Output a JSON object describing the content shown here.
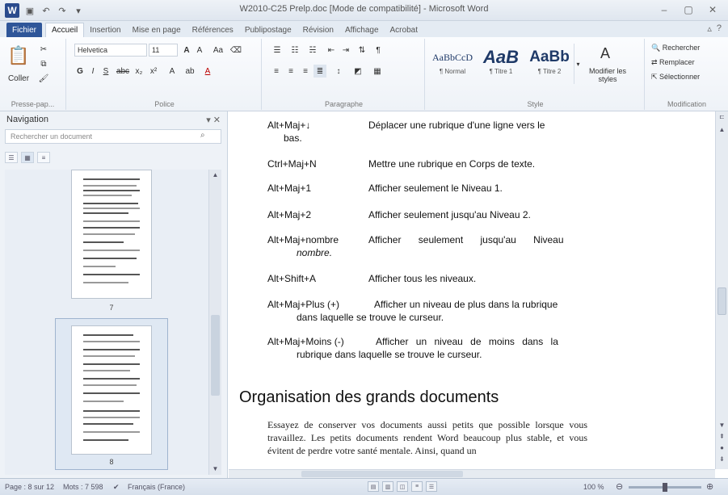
{
  "window": {
    "title": "W2010-C25 Prelp.doc [Mode de compatibilité] - Microsoft Word"
  },
  "qat": {
    "logo": "W",
    "save_icon": "save-icon",
    "undo_icon": "undo-icon",
    "redo_icon": "redo-icon"
  },
  "tabs": [
    {
      "label": "Fichier"
    },
    {
      "label": "Accueil"
    },
    {
      "label": "Insertion"
    },
    {
      "label": "Mise en page"
    },
    {
      "label": "Références"
    },
    {
      "label": "Publipostage"
    },
    {
      "label": "Révision"
    },
    {
      "label": "Affichage"
    },
    {
      "label": "Acrobat"
    }
  ],
  "ribbon": {
    "clipboard": {
      "paste_label": "Coller",
      "group_label": "Presse-pap..."
    },
    "font": {
      "name": "Helvetica",
      "size": "11",
      "group_label": "Police"
    },
    "paragraph": {
      "group_label": "Paragraphe"
    },
    "styles": {
      "items": [
        {
          "preview": "AaBbCcD",
          "label": "¶ Normal"
        },
        {
          "preview": "AaB",
          "label": "¶ Titre 1"
        },
        {
          "preview": "AaBb",
          "label": "¶ Titre 2"
        }
      ],
      "modify_label": "Modifier les styles",
      "group_label": "Style"
    },
    "editing": {
      "find": "Rechercher",
      "replace": "Remplacer",
      "select": "Sélectionner",
      "group_label": "Modification"
    }
  },
  "navigation": {
    "title": "Navigation",
    "search_placeholder": "Rechercher un document",
    "pages": [
      {
        "number": "7"
      },
      {
        "number": "8"
      }
    ]
  },
  "document": {
    "rows": [
      {
        "key": "Alt+Maj+↓",
        "desc": "Déplacer une rubrique d'une ligne vers le",
        "cont": "bas."
      },
      {
        "key": "Ctrl+Maj+N",
        "desc": "Mettre une rubrique en Corps de texte.",
        "cont": ""
      },
      {
        "key": "Alt+Maj+1",
        "desc": "Afficher seulement le Niveau 1.",
        "cont": ""
      },
      {
        "key": "Alt+Maj+2",
        "desc": "Afficher seulement jusqu'au Niveau 2.",
        "cont": ""
      },
      {
        "key": "Alt+Maj+nombre",
        "desc": "Afficher seulement jusqu'au Niveau",
        "cont": "nombre."
      },
      {
        "key": "Alt+Shift+A",
        "desc": "Afficher tous les niveaux.",
        "cont": ""
      },
      {
        "key": "Alt+Maj+Plus (+)",
        "desc": "Afficher un niveau de plus dans la rubrique",
        "cont": "dans laquelle se trouve le curseur."
      },
      {
        "key": "Alt+Maj+Moins (-)",
        "desc": "Afficher un niveau de moins dans la",
        "cont": "rubrique dans laquelle se trouve le curseur."
      }
    ],
    "heading": "Organisation des grands documents",
    "paragraph": "Essayez de conserver vos documents aussi petits que possible lorsque vous travaillez. Les petits documents rendent Word beaucoup plus stable, et vous évitent de perdre votre santé mentale. Ainsi, quand un"
  },
  "status": {
    "page": "Page : 8 sur 12",
    "words": "Mots : 7 598",
    "language": "Français (France)",
    "zoom": "100 %"
  }
}
